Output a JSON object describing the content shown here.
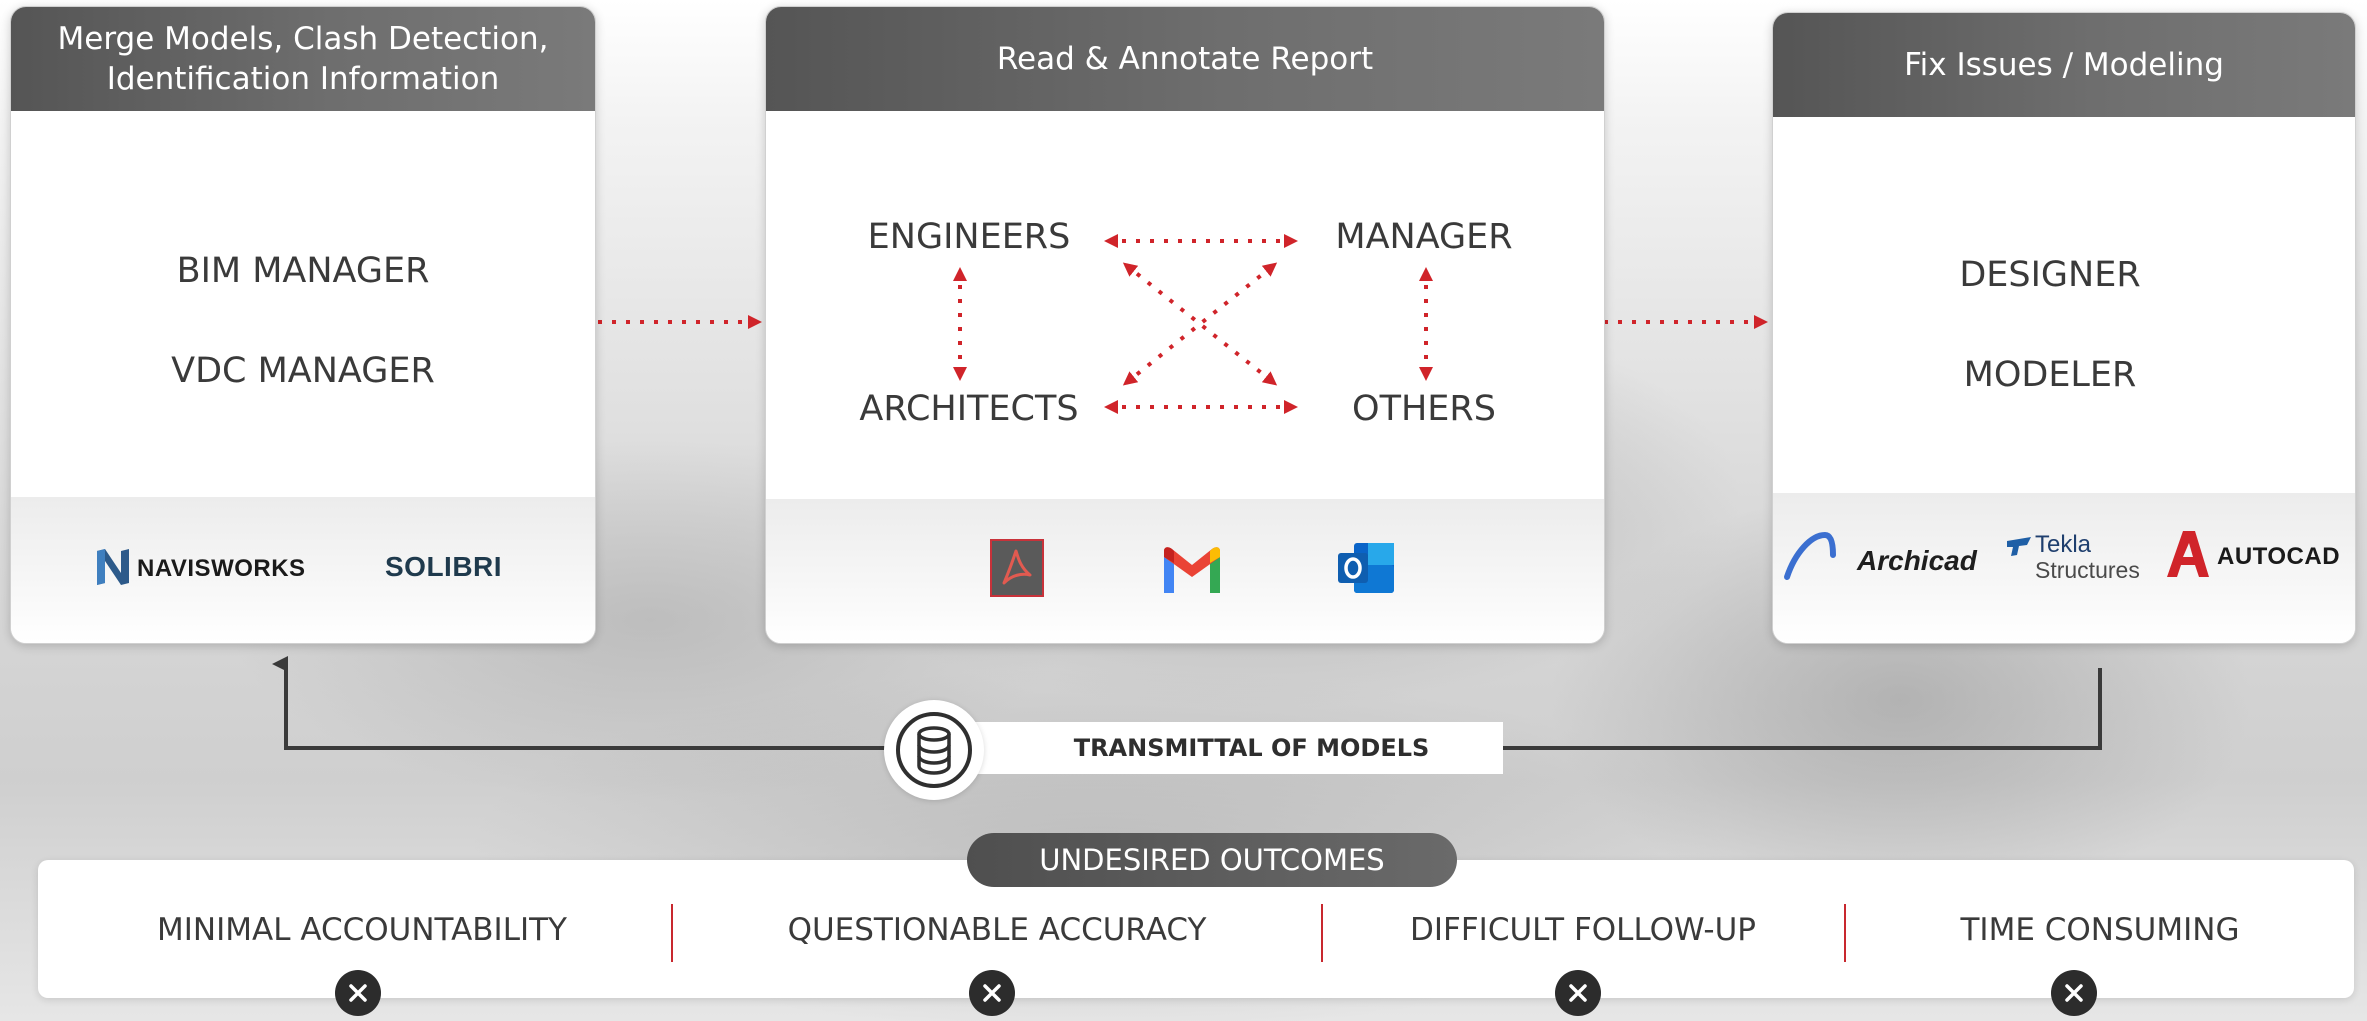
{
  "colors": {
    "header_gray": "#5a5a5a",
    "accent_red": "#d0242a",
    "text_dark": "#3a3a3a"
  },
  "cards": {
    "left": {
      "header_line1": "Merge Models, Clash Detection,",
      "header_line2": "Identification Information",
      "roles": [
        "BIM MANAGER",
        "VDC MANAGER"
      ],
      "logos": [
        "NAVISWORKS",
        "SOLIBRI"
      ]
    },
    "middle": {
      "header": "Read & Annotate Report",
      "nodes": {
        "top_left": "ENGINEERS",
        "top_right": "MANAGER",
        "bottom_left": "ARCHITECTS",
        "bottom_right": "OTHERS"
      },
      "icons": [
        "acrobat-icon",
        "gmail-icon",
        "outlook-icon"
      ]
    },
    "right": {
      "header": "Fix Issues / Modeling",
      "roles": [
        "DESIGNER",
        "MODELER"
      ],
      "logos": {
        "archicad": "Archicad",
        "tekla_top": "Tekla",
        "tekla_bottom": "Structures",
        "autocad": "AUTOCAD"
      }
    }
  },
  "transmittal": {
    "label": "TRANSMITTAL OF MODELS",
    "icon": "database-icon"
  },
  "outcomes": {
    "title": "UNDESIRED OUTCOMES",
    "items": [
      "MINIMAL ACCOUNTABILITY",
      "QUESTIONABLE ACCURACY",
      "DIFFICULT FOLLOW-UP",
      "TIME CONSUMING"
    ]
  }
}
